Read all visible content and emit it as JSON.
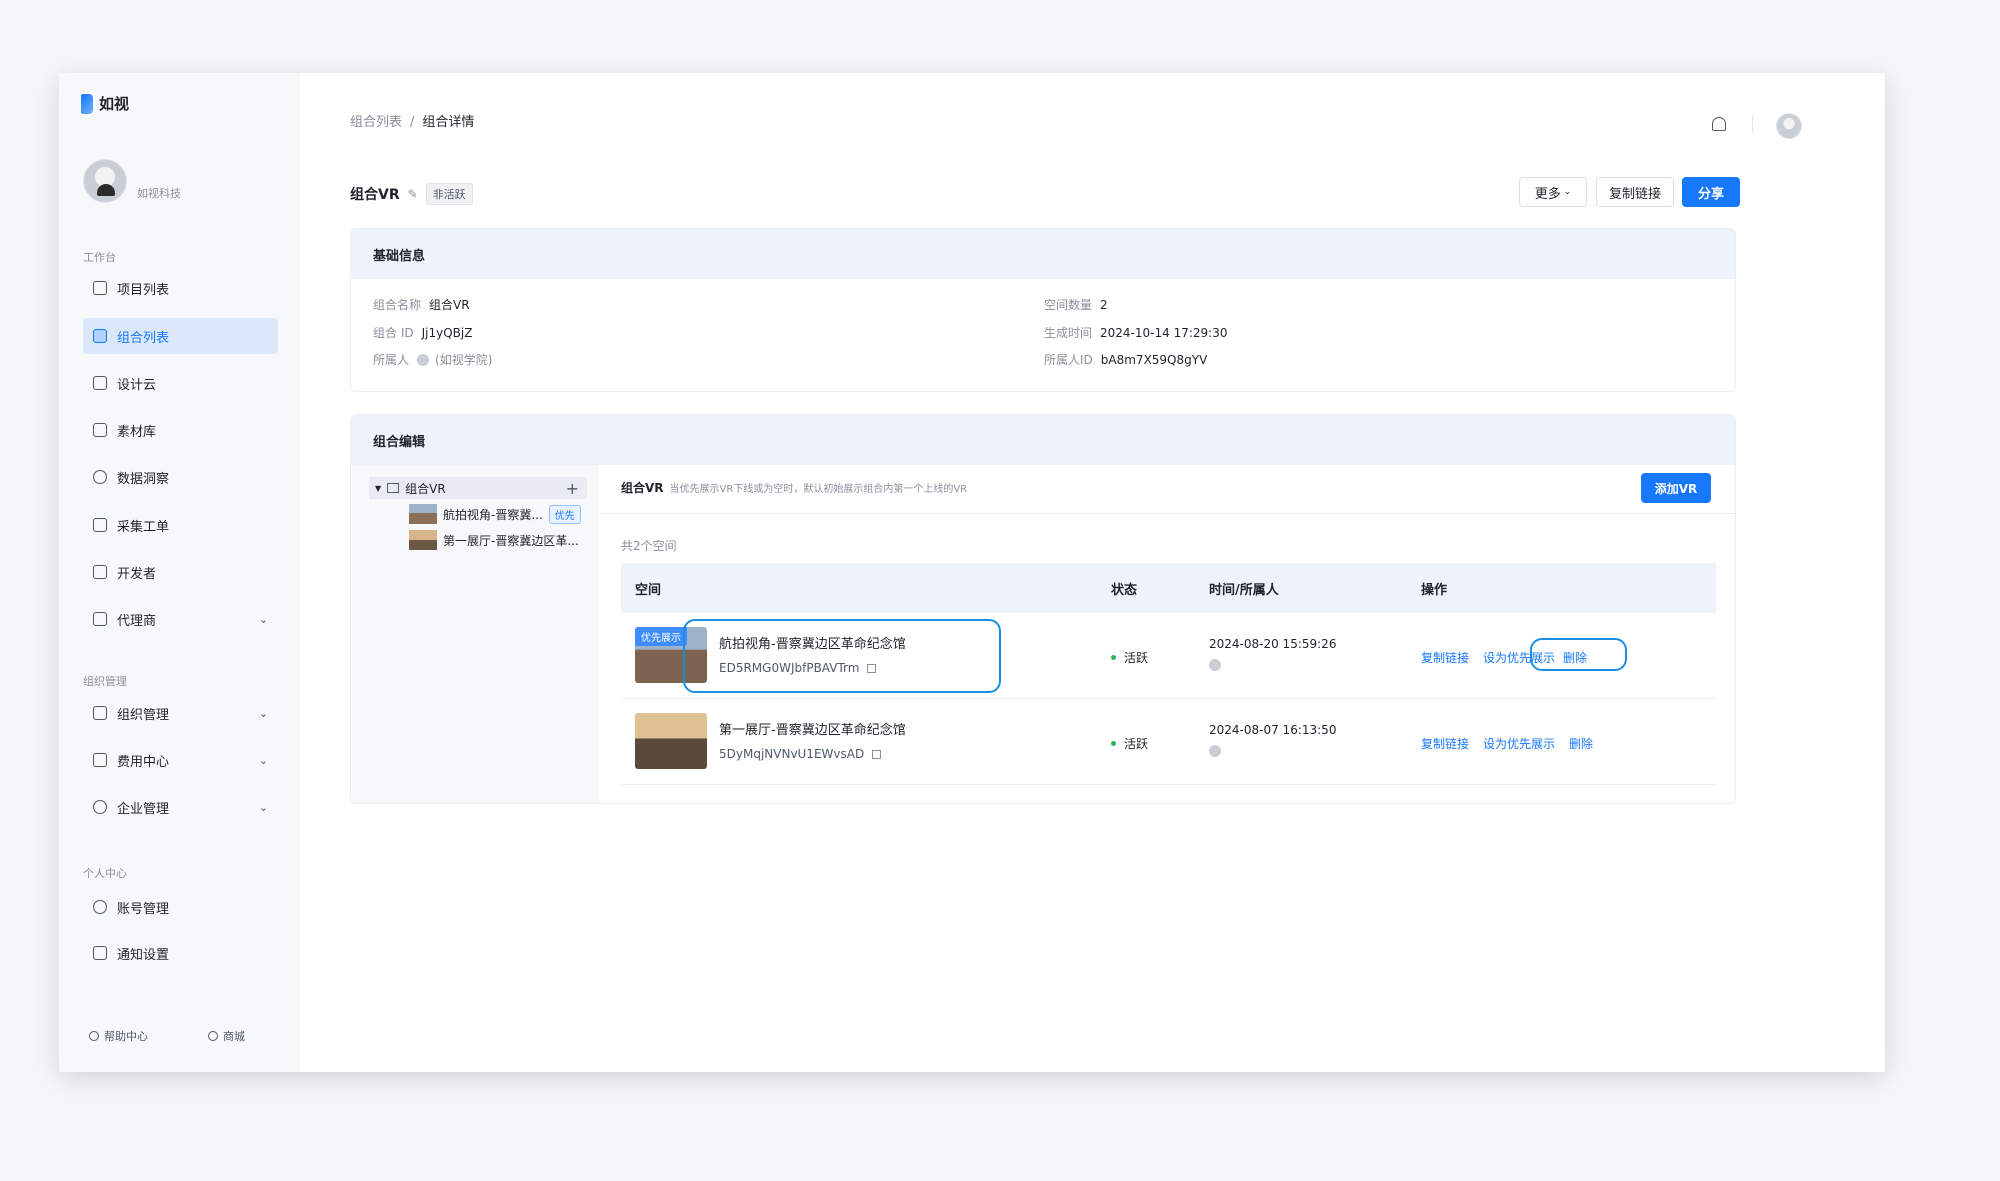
{
  "brand": {
    "name": "如视"
  },
  "profile": {
    "name": "如视科技"
  },
  "sidebar": {
    "sections": [
      "工作台",
      "组织管理",
      "个人中心"
    ],
    "items": [
      {
        "label": "项目列表",
        "icon": "vr-icon"
      },
      {
        "label": "组合列表",
        "icon": "layers-icon",
        "active": true
      },
      {
        "label": "设计云",
        "icon": "monitor-icon"
      },
      {
        "label": "素材库",
        "icon": "folder-icon"
      },
      {
        "label": "数据洞察",
        "icon": "pie-chart-icon"
      },
      {
        "label": "采集工单",
        "icon": "document-icon"
      },
      {
        "label": "开发者",
        "icon": "code-icon"
      },
      {
        "label": "代理商",
        "icon": "briefcase-icon",
        "expandable": true
      },
      {
        "label": "组织管理",
        "icon": "org-icon",
        "expandable": true
      },
      {
        "label": "费用中心",
        "icon": "wallet-icon",
        "expandable": true
      },
      {
        "label": "企业管理",
        "icon": "shield-icon",
        "expandable": true
      },
      {
        "label": "账号管理",
        "icon": "user-icon"
      },
      {
        "label": "通知设置",
        "icon": "bell-icon"
      }
    ],
    "footer": {
      "help": "帮助中心",
      "shop": "商城"
    }
  },
  "breadcrumb": {
    "parent": "组合列表",
    "sep": "/",
    "current": "组合详情"
  },
  "header": {
    "title": "组合VR",
    "status_badge": "非活跃",
    "more": "更多",
    "copy_link": "复制链接",
    "share": "分享"
  },
  "basic_info": {
    "heading": "基础信息",
    "name_label": "组合名称",
    "name_value": "组合VR",
    "id_label": "组合 ID",
    "id_value": "Jj1yQBjZ",
    "owner_label": "所属人",
    "owner_value": "(如视学院)",
    "count_label": "空间数量",
    "count_value": "2",
    "created_label": "生成时间",
    "created_value": "2024-10-14 17:29:30",
    "owner_id_label": "所属人ID",
    "owner_id_value": "bA8m7X59Q8gYV"
  },
  "edit": {
    "heading": "组合编辑",
    "tree": {
      "root": "组合VR",
      "children": [
        {
          "label": "航拍视角-晋察冀...",
          "tag": "优先"
        },
        {
          "label": "第一展厅-晋察冀边区革..."
        }
      ]
    },
    "pane_title": "组合VR",
    "pane_hint": "当优先展示VR下线或为空时，默认初始展示组合内第一个上线的VR",
    "add_vr": "添加VR",
    "count_text": "共2个空间",
    "columns": {
      "space": "空间",
      "status": "状态",
      "time": "时间/所属人",
      "ops": "操作"
    },
    "rows": [
      {
        "tag": "优先展示",
        "name": "航拍视角-晋察冀边区革命纪念馆",
        "id": "ED5RMG0WJbfPBAVTrm",
        "status": "活跃",
        "time": "2024-08-20 15:59:26",
        "op_copy": "复制链接",
        "op_priority": "设为优先展示",
        "op_delete": "删除"
      },
      {
        "name": "第一展厅-晋察冀边区革命纪念馆",
        "id": "5DyMqjNVNvU1EWvsAD",
        "status": "活跃",
        "time": "2024-08-07 16:13:50",
        "op_copy": "复制链接",
        "op_priority": "设为优先展示",
        "op_delete": "删除"
      }
    ]
  }
}
